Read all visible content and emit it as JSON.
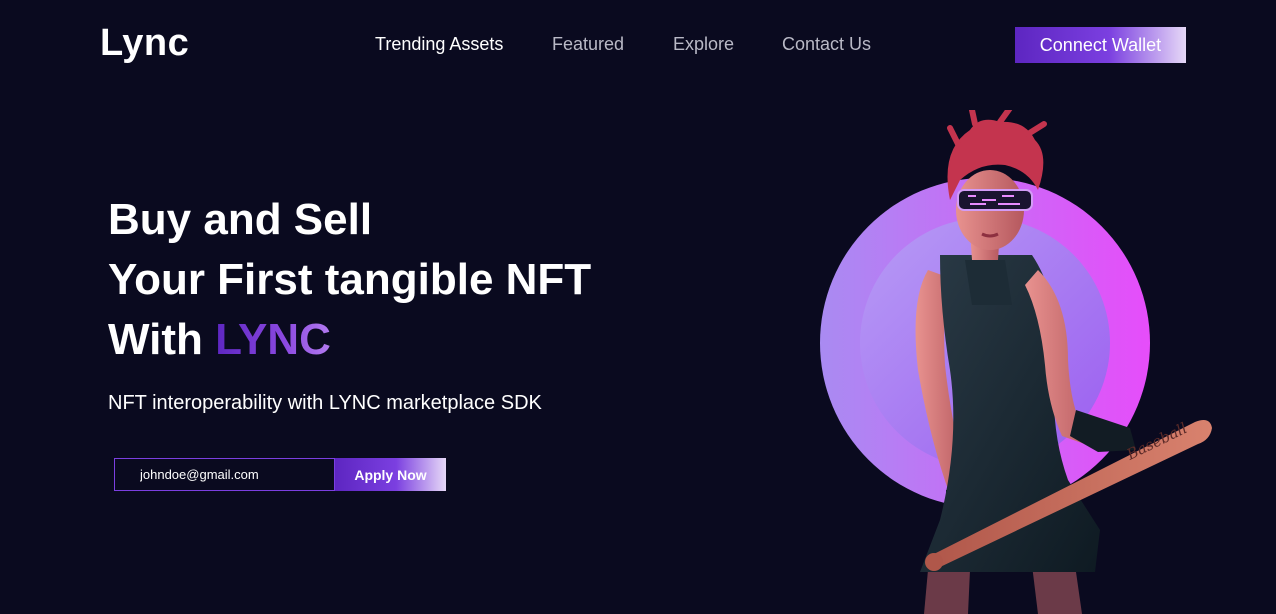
{
  "header": {
    "logo": "Lync",
    "nav": [
      "Trending Assets",
      "Featured",
      "Explore",
      "Contact Us"
    ],
    "cta": "Connect Wallet"
  },
  "hero": {
    "line1": "Buy and Sell",
    "line2": "Your First tangible NFT",
    "line3_prefix": "With ",
    "line3_accent": "LYNC",
    "subtitle": "NFT interoperability with LYNC marketplace SDK",
    "email_value": "johndoe@gmail.com",
    "apply": "Apply Now",
    "bat_text": "Baseball",
    "image": "nft-character-with-bat"
  },
  "colors": {
    "background": "#0a0a1f",
    "accent": "#7b3fe0",
    "circle_outer": "#c56cf5",
    "circle_inner": "#a86cf0"
  }
}
